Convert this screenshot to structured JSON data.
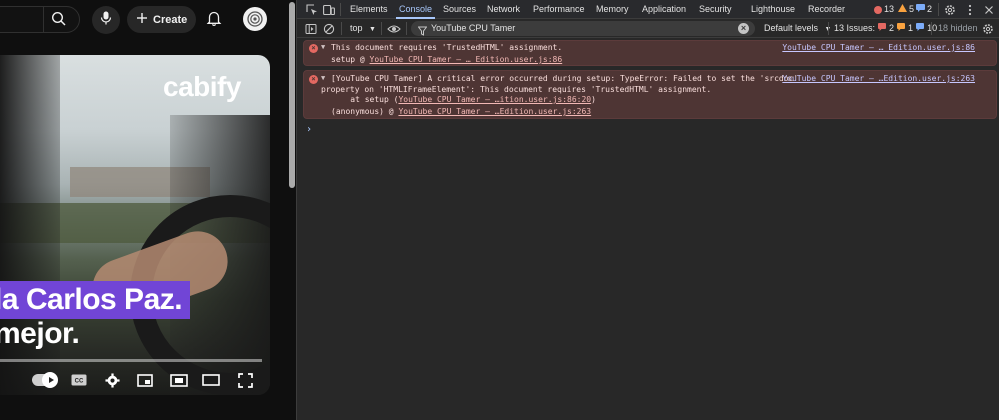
{
  "youtube": {
    "create_label": "Create",
    "video_logo": "cabify",
    "caption_line1_a": "la Carlos Paz.",
    "caption_line2": "mejor."
  },
  "devtools": {
    "tabs": [
      "Elements",
      "Console",
      "Sources",
      "Network",
      "Performance",
      "Memory",
      "Application",
      "Security",
      "Lighthouse",
      "Recorder"
    ],
    "active_tab": "Console",
    "counts": {
      "errors": "13",
      "warnings": "5",
      "info": "2"
    },
    "toolbar": {
      "context": "top",
      "filter_value": "YouTube CPU Tamer",
      "levels": "Default levels",
      "issues_label": "13 Issues:",
      "issues_errors": "2",
      "issues_warnings": "1",
      "issues_info": "10",
      "hidden": "18 hidden"
    },
    "messages": [
      {
        "text": "This document requires 'TrustedHTML' assignment.",
        "source": "YouTube CPU Tamer – … Edition.user.js:86",
        "stack": [
          {
            "fn": "setup @ ",
            "link": "YouTube CPU Tamer – … Edition.user.js:86"
          }
        ]
      },
      {
        "text": "[YouTube CPU Tamer] A critical error occurred during setup: TypeError: Failed to set the 'srcdoc'",
        "text2": "property on 'HTMLIFrameElement': This document requires 'TrustedHTML' assignment.",
        "text3_prefix": "    at setup (",
        "text3_link": "YouTube CPU Tamer – …ition.user.js:86:20",
        "text3_suffix": ")",
        "source": "YouTube CPU Tamer – …Edition.user.js:263",
        "stack": [
          {
            "fn": "(anonymous) @ ",
            "link": "YouTube CPU Tamer – …Edition.user.js:263"
          }
        ]
      }
    ],
    "prompt": "›"
  }
}
